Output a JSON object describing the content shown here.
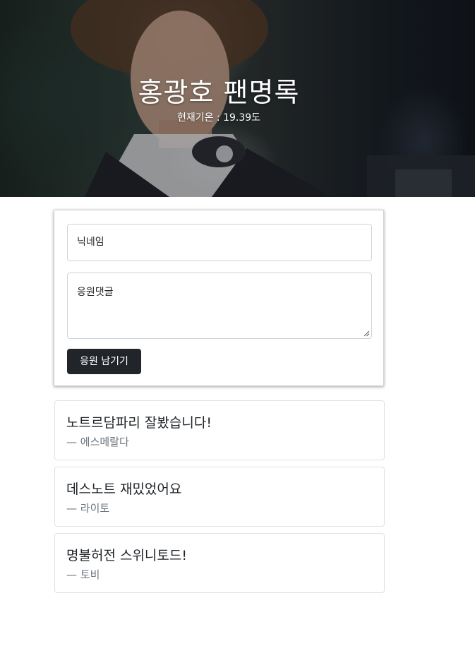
{
  "header": {
    "title": "홍광호 팬명록",
    "temperature_text": "현재기온 : 19.39도"
  },
  "form": {
    "nickname_placeholder": "닉네임",
    "comment_placeholder": "응원댓글",
    "submit_label": "응원 남기기"
  },
  "comments": [
    {
      "text": "노트르담파리 잘봤습니다!",
      "author": "— 에스메랄다"
    },
    {
      "text": "데스노트 재밌었어요",
      "author": "— 라이토"
    },
    {
      "text": "명불허전 스위니토드!",
      "author": "— 토비"
    }
  ]
}
